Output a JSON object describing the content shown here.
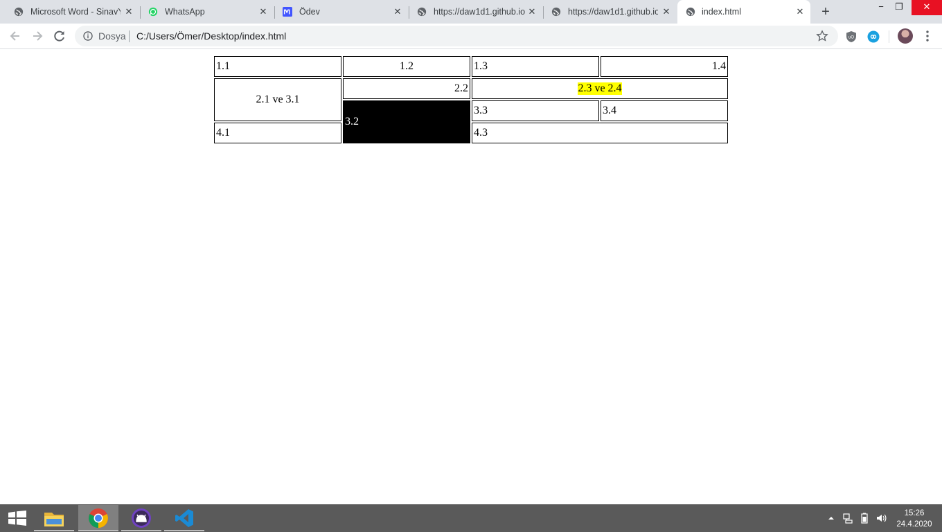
{
  "browser": {
    "tabs": [
      {
        "title": "Microsoft Word - SinavY",
        "icon": "globe-icon",
        "active": false
      },
      {
        "title": "WhatsApp",
        "icon": "whatsapp-icon",
        "active": false
      },
      {
        "title": "Ödev",
        "icon": "miro-icon",
        "active": false
      },
      {
        "title": "https://daw1d1.github.io",
        "icon": "globe-icon",
        "active": false
      },
      {
        "title": "https://daw1d1.github.io",
        "icon": "globe-icon",
        "active": false
      },
      {
        "title": "index.html",
        "icon": "globe-icon",
        "active": true
      }
    ],
    "new_tab_label": "+",
    "window_buttons": {
      "minimize": "−",
      "restore": "❐",
      "close": "✕"
    },
    "address": {
      "scheme_label": "Dosya",
      "url": "C:/Users/Ömer/Desktop/index.html"
    },
    "colors": {
      "tabstrip": "#dee1e6",
      "omnibox": "#f1f3f4",
      "accent": "#1a73e8"
    }
  },
  "table": {
    "r1c1": "1.1",
    "r1c2": "1.2",
    "r1c3": "1.3",
    "r1c4": "1.4",
    "r2c1": "2.1 ve 3.1",
    "r2c2": "2.2",
    "r2c3": "2.3 ve 2.4",
    "r3c2": "3.2",
    "r3c3": "3.3",
    "r3c4": "3.4",
    "r4c1": "4.1",
    "r4c3": "4.3",
    "highlight_color": "#ffff00",
    "dark_cell_color": "#000000"
  },
  "taskbar": {
    "apps": [
      "file-explorer-icon",
      "chrome-icon",
      "github-desktop-icon",
      "vscode-icon"
    ],
    "active_app": "chrome-icon",
    "time": "15:26",
    "date": "24.4.2020"
  }
}
